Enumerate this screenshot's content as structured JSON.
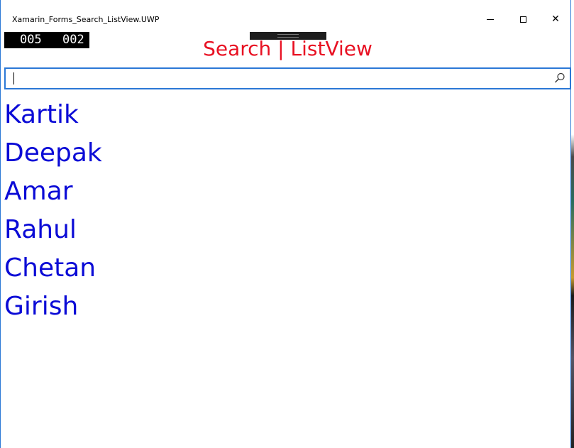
{
  "window": {
    "title": "Xamarin_Forms_Search_ListView.UWP",
    "controls": {
      "minimize_icon": "minimize-icon",
      "maximize_icon": "maximize-icon",
      "close_icon": "close-icon",
      "close_glyph": "✕"
    }
  },
  "debug_counter": {
    "left": "005",
    "right": "002"
  },
  "page": {
    "heading": "Search | ListView"
  },
  "search": {
    "value": "",
    "icon": "search-icon"
  },
  "list": {
    "items": [
      "Kartik",
      "Deepak",
      "Amar",
      "Rahul",
      "Chetan",
      "Girish"
    ]
  },
  "colors": {
    "heading": "#e81123",
    "list_text": "#0b0bd6",
    "accent_border": "#2b78d6"
  }
}
